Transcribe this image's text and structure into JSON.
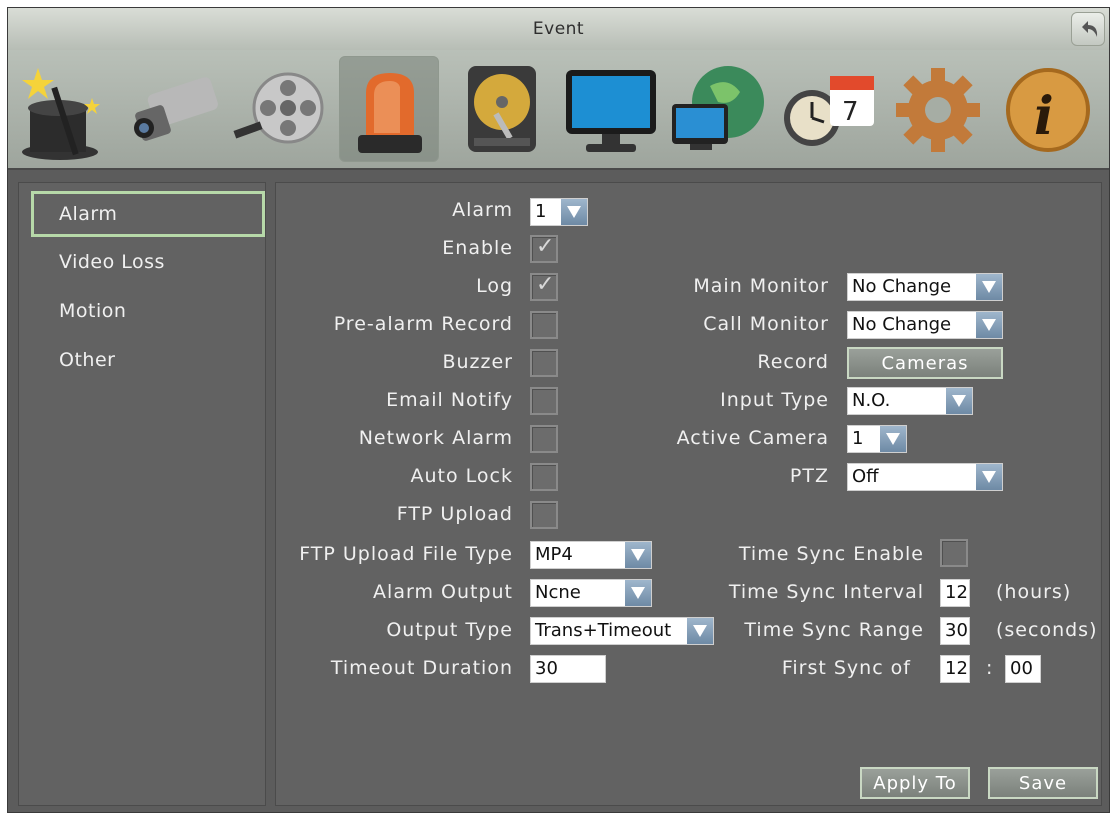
{
  "window": {
    "title": "Event"
  },
  "toolbar": {
    "icons": [
      "wizard-icon",
      "camera-icon",
      "film-reel-icon",
      "alarm-light-icon",
      "hard-drive-icon",
      "monitor-icon",
      "network-icon",
      "schedule-icon",
      "gear-icon",
      "info-icon"
    ],
    "selected": "alarm-light-icon"
  },
  "sidebar": {
    "items": [
      {
        "label": "Alarm"
      },
      {
        "label": "Video Loss"
      },
      {
        "label": "Motion"
      },
      {
        "label": "Other"
      }
    ]
  },
  "left": {
    "alarm": {
      "label": "Alarm",
      "value": "1"
    },
    "enable": {
      "label": "Enable",
      "checked": true
    },
    "log": {
      "label": "Log",
      "checked": true
    },
    "pre_alarm": {
      "label": "Pre-alarm Record",
      "checked": false
    },
    "buzzer": {
      "label": "Buzzer",
      "checked": false
    },
    "email": {
      "label": "Email Notify",
      "checked": false
    },
    "network_alarm": {
      "label": "Network Alarm",
      "checked": false
    },
    "auto_lock": {
      "label": "Auto Lock",
      "checked": false
    },
    "ftp_upload": {
      "label": "FTP Upload",
      "checked": false
    },
    "ftp_type": {
      "label": "FTP Upload File Type",
      "value": "MP4"
    },
    "alarm_output": {
      "label": "Alarm Output",
      "value": "Ncne"
    },
    "output_type": {
      "label": "Output Type",
      "value": "Trans+Timeout"
    },
    "timeout": {
      "label": "Timeout Duration",
      "value": "30"
    }
  },
  "right": {
    "main_monitor": {
      "label": "Main Monitor",
      "value": "No Change"
    },
    "call_monitor": {
      "label": "Call Monitor",
      "value": "No Change"
    },
    "record": {
      "label": "Record",
      "button": "Cameras"
    },
    "input_type": {
      "label": "Input Type",
      "value": "N.O."
    },
    "active_camera": {
      "label": "Active Camera",
      "value": "1"
    },
    "ptz": {
      "label": "PTZ",
      "value": "Off"
    },
    "time_sync_enable": {
      "label": "Time Sync Enable",
      "checked": false
    },
    "time_sync_interval": {
      "label": "Time Sync Interval",
      "value": "12",
      "unit": "(hours)"
    },
    "time_sync_range": {
      "label": "Time Sync Range",
      "value": "30",
      "unit": "(seconds)"
    },
    "first_sync": {
      "label": "First Sync of",
      "hour": "12",
      "sep": ":",
      "minute": "00"
    }
  },
  "footer": {
    "apply_label": "Apply To",
    "save_label": "Save"
  },
  "colors": {
    "panel": "#626262",
    "highlight": "#b7d9a9",
    "dropdown_arrow": "#7e98b2"
  }
}
